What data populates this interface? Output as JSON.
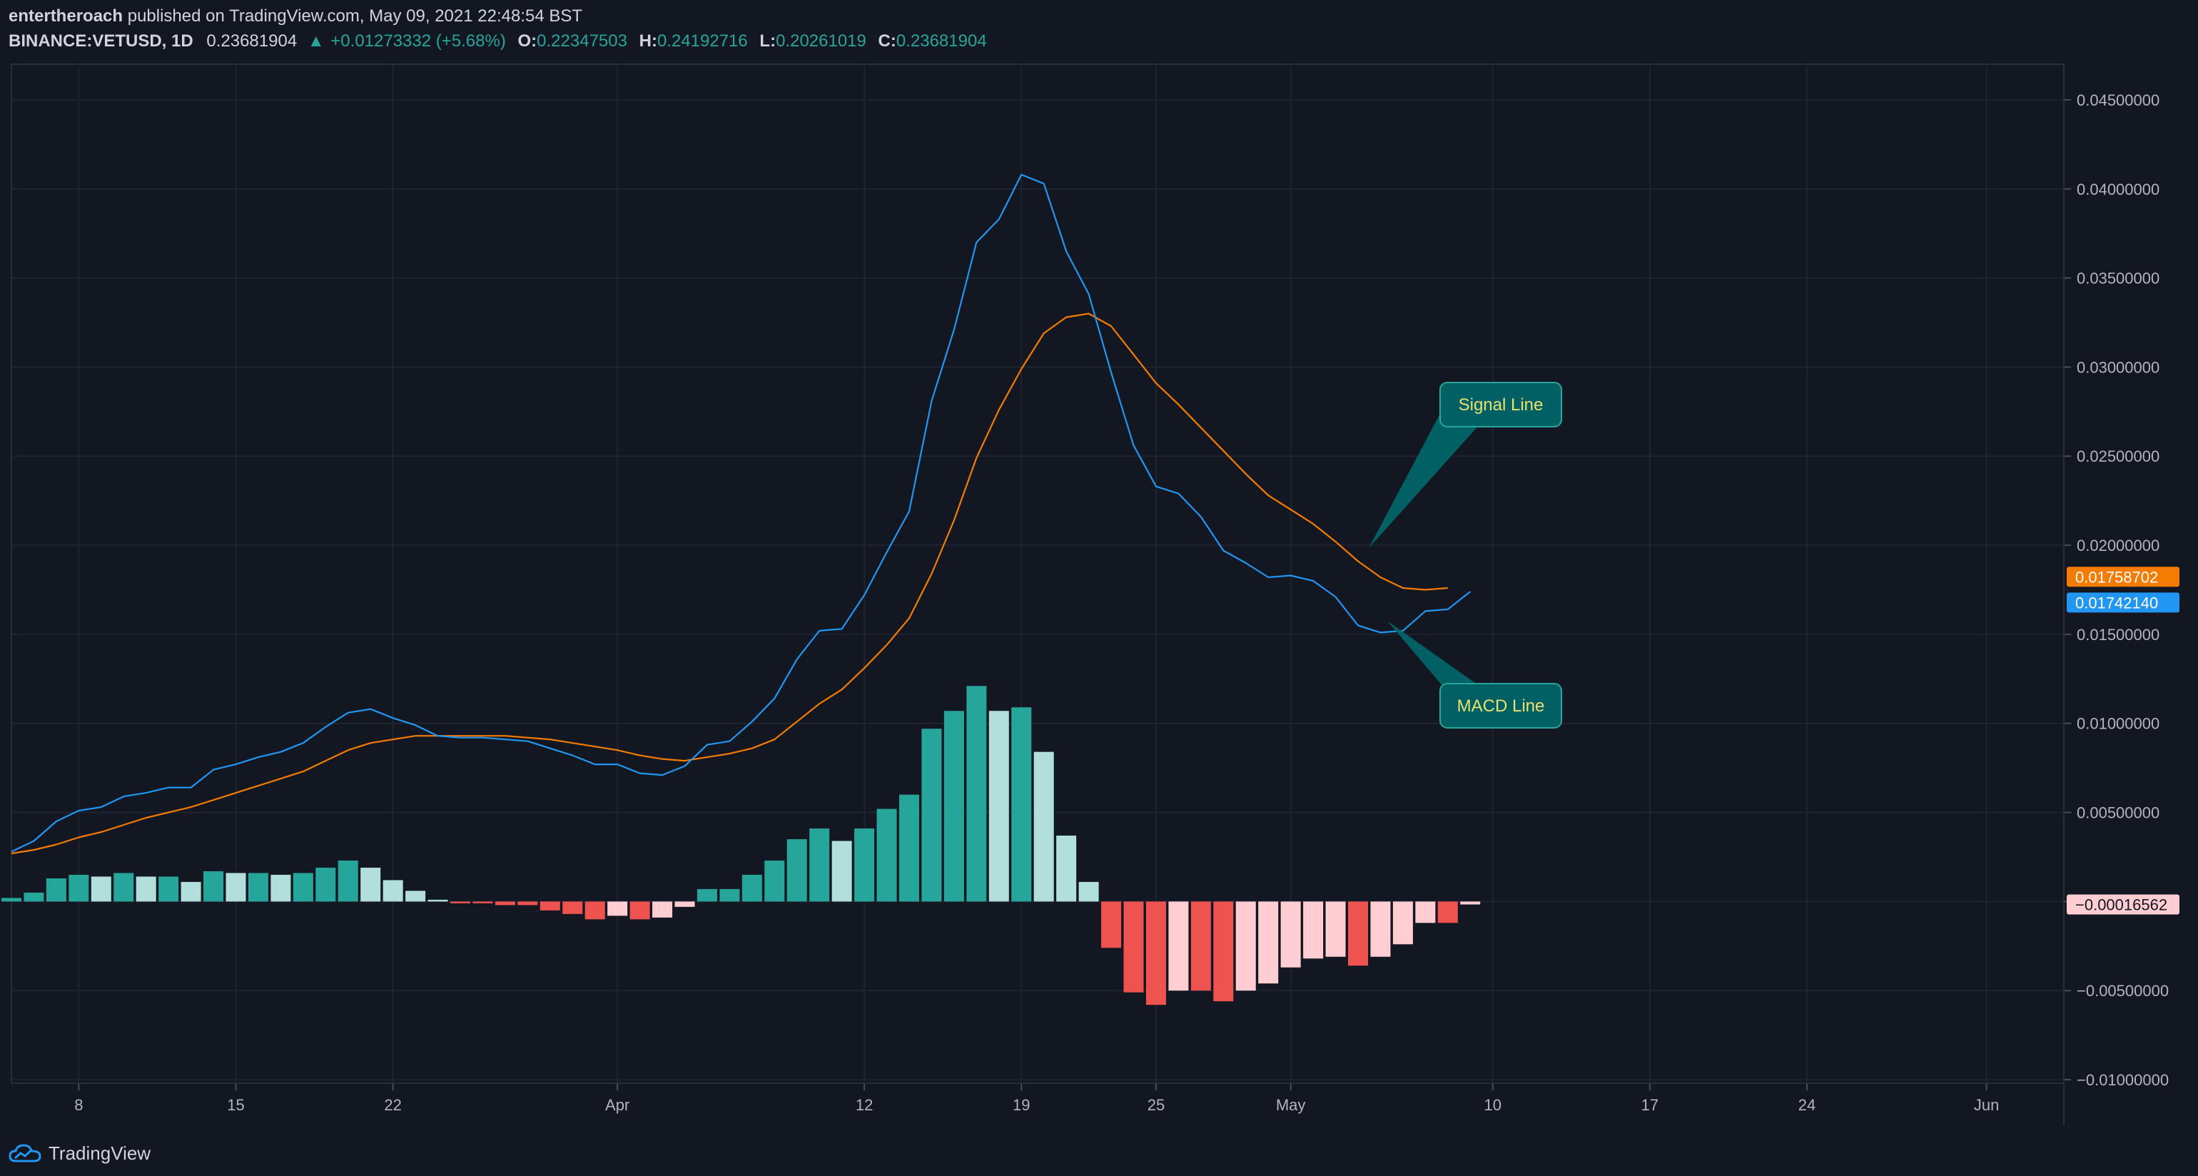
{
  "header": {
    "author": "entertheroach",
    "published": "published on TradingView.com, May 09, 2021 22:48:54 BST",
    "symbol": "BINANCE:VETUSD, 1D",
    "price": "0.23681904",
    "change_arrow": "▲",
    "change": "+0.01273332 (+5.68%)",
    "o_label": "O:",
    "o_value": "0.22347503",
    "h_label": "H:",
    "h_value": "0.24192716",
    "l_label": "L:",
    "l_value": "0.20261019",
    "c_label": "C:",
    "c_value": "0.23681904"
  },
  "footer": {
    "brand": "TradingView",
    "logo_icon": "tradingview-logo-icon"
  },
  "annotations": {
    "signal": "Signal Line",
    "macd": "MACD Line"
  },
  "colors": {
    "background": "#131722",
    "grid": "#232733",
    "text": "#b2b5be",
    "macd": "#2196f3",
    "signal": "#f57c00",
    "hist_pos_strong": "#26a69a",
    "hist_pos_weak": "#b2dfdb",
    "hist_neg_strong": "#ef5350",
    "hist_neg_weak": "#ffcdd2",
    "callout": "#006064"
  },
  "chart_data": {
    "type": "line",
    "y_ticks": [
      "0.04500000",
      "0.04000000",
      "0.03500000",
      "0.03000000",
      "0.02500000",
      "0.02000000",
      "0.01500000",
      "0.01000000",
      "0.00500000",
      "0.00000000",
      "−0.00500000",
      "−0.01000000"
    ],
    "y_tick_values": [
      0.045,
      0.04,
      0.035,
      0.03,
      0.025,
      0.02,
      0.015,
      0.01,
      0.005,
      0,
      -0.005,
      -0.01
    ],
    "ylim": [
      -0.0102,
      0.047
    ],
    "x_tick_labels": [
      {
        "label": "8",
        "day": 4
      },
      {
        "label": "15",
        "day": 11
      },
      {
        "label": "22",
        "day": 18
      },
      {
        "label": "Apr",
        "day": 28
      },
      {
        "label": "12",
        "day": 39
      },
      {
        "label": "19",
        "day": 46
      },
      {
        "label": "25",
        "day": 52
      },
      {
        "label": "May",
        "day": 58
      },
      {
        "label": "10",
        "day": 67
      },
      {
        "label": "17",
        "day": 74
      },
      {
        "label": "24",
        "day": 81
      },
      {
        "label": "Jun",
        "day": 89
      }
    ],
    "x_range_days": [
      1,
      93
    ],
    "series": [
      {
        "name": "MACD Line",
        "values": [
          0.0028,
          0.0034,
          0.0045,
          0.0051,
          0.0053,
          0.0059,
          0.0061,
          0.0064,
          0.0064,
          0.0074,
          0.0077,
          0.0081,
          0.0084,
          0.0089,
          0.0098,
          0.0106,
          0.0108,
          0.0103,
          0.0099,
          0.0093,
          0.0092,
          0.0092,
          0.0091,
          0.009,
          0.0086,
          0.0082,
          0.0077,
          0.0077,
          0.0072,
          0.0071,
          0.0076,
          0.0088,
          0.009,
          0.0101,
          0.0114,
          0.0136,
          0.0152,
          0.0153,
          0.0172,
          0.0196,
          0.0219,
          0.0281,
          0.0321,
          0.037,
          0.0383,
          0.0408,
          0.0403,
          0.0365,
          0.0341,
          0.0297,
          0.0256,
          0.0233,
          0.0229,
          0.0216,
          0.0197,
          0.019,
          0.0182,
          0.0183,
          0.018,
          0.0171,
          0.0155,
          0.0151,
          0.0152,
          0.0163,
          0.0164,
          0.0174
        ]
      },
      {
        "name": "Signal Line",
        "values": [
          0.0027,
          0.0029,
          0.0032,
          0.0036,
          0.0039,
          0.0043,
          0.0047,
          0.005,
          0.0053,
          0.0057,
          0.0061,
          0.0065,
          0.0069,
          0.0073,
          0.0079,
          0.0085,
          0.0089,
          0.0091,
          0.0093,
          0.0093,
          0.0093,
          0.0093,
          0.0093,
          0.0092,
          0.0091,
          0.0089,
          0.0087,
          0.0085,
          0.0082,
          0.008,
          0.0079,
          0.0081,
          0.0083,
          0.0086,
          0.0091,
          0.0101,
          0.0111,
          0.0119,
          0.0131,
          0.0144,
          0.0159,
          0.0184,
          0.0214,
          0.0249,
          0.0276,
          0.0299,
          0.0319,
          0.0328,
          0.033,
          0.0323,
          0.0307,
          0.0291,
          0.0279,
          0.0266,
          0.0253,
          0.024,
          0.0228,
          0.022,
          0.0212,
          0.0202,
          0.0191,
          0.0182,
          0.0176,
          0.0175,
          0.0176
        ]
      },
      {
        "name": "Histogram",
        "values": [
          0.0002,
          0.0005,
          0.0013,
          0.0015,
          0.0014,
          0.0016,
          0.0014,
          0.0014,
          0.0011,
          0.0017,
          0.0016,
          0.0016,
          0.0015,
          0.0016,
          0.0019,
          0.0023,
          0.0019,
          0.0012,
          0.0006,
          0.0001,
          -0.0001,
          -0.0001,
          -0.0002,
          -0.0002,
          -0.0005,
          -0.0007,
          -0.001,
          -0.0008,
          -0.001,
          -0.0009,
          -0.0003,
          0.0007,
          0.0007,
          0.0015,
          0.0023,
          0.0035,
          0.0041,
          0.0034,
          0.0041,
          0.0052,
          0.006,
          0.0097,
          0.0107,
          0.0121,
          0.0107,
          0.0109,
          0.0084,
          0.0037,
          0.0011,
          -0.0026,
          -0.0051,
          -0.0058,
          -0.005,
          -0.005,
          -0.0056,
          -0.005,
          -0.0046,
          -0.0037,
          -0.0032,
          -0.0031,
          -0.0036,
          -0.0031,
          -0.0024,
          -0.0012,
          -0.0012,
          -0.00016562
        ]
      }
    ],
    "price_labels": [
      {
        "series": "Signal Line",
        "text": "0.01758702",
        "value": 0.01758702
      },
      {
        "series": "MACD Line",
        "text": "0.01742140",
        "value": 0.0174214
      },
      {
        "series": "Histogram",
        "text": "−0.00016562",
        "value": -0.00016562
      }
    ]
  }
}
